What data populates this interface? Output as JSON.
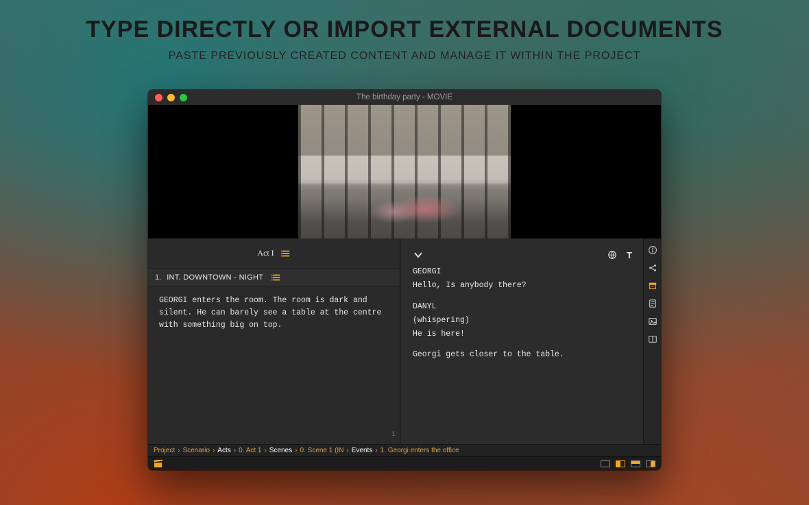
{
  "promo": {
    "headline": "TYPE DIRECTLY OR IMPORT EXTERNAL DOCUMENTS",
    "subhead": "PASTE PREVIOUSLY CREATED CONTENT AND MANAGE IT WITHIN THE PROJECT"
  },
  "window": {
    "title": "The birthday party - MOVIE"
  },
  "left": {
    "act_label": "Act I",
    "scene": {
      "number": "1.",
      "slug": "INT. DOWNTOWN - NIGHT"
    },
    "body": "GEORGI enters the room. The room is dark and silent. He can barely see a table at the centre with something big on top.",
    "page": "1"
  },
  "right": {
    "lines": [
      "GEORGI",
      "Hello, Is anybody there?",
      "",
      "DANYL",
      "(whispering)",
      "He is here!",
      "",
      "Georgi gets closer to the table."
    ],
    "text_tool": "T"
  },
  "breadcrumbs": [
    {
      "t": "Project",
      "cur": false
    },
    {
      "t": "Scenario",
      "cur": false
    },
    {
      "t": "Acts",
      "cur": true
    },
    {
      "t": "0. Act 1",
      "cur": false
    },
    {
      "t": "Scenes",
      "cur": true
    },
    {
      "t": "0. Scene 1 (IN",
      "cur": false
    },
    {
      "t": "Events",
      "cur": true
    },
    {
      "t": "1. Georgi enters the office",
      "cur": false
    }
  ]
}
